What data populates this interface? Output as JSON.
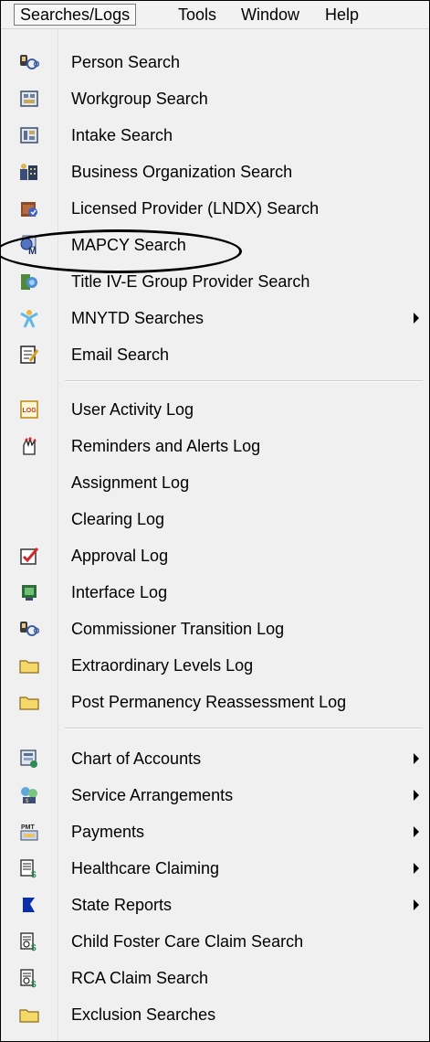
{
  "menubar": {
    "items": [
      "Searches/Logs",
      "Tools",
      "Window",
      "Help"
    ]
  },
  "menu": {
    "items": [
      {
        "label": "Person Search",
        "icon": "binoculars-icon",
        "submenu": false
      },
      {
        "label": "Workgroup Search",
        "icon": "workgroup-icon",
        "submenu": false
      },
      {
        "label": "Intake Search",
        "icon": "intake-icon",
        "submenu": false
      },
      {
        "label": "Business Organization Search",
        "icon": "business-org-icon",
        "submenu": false
      },
      {
        "label": "Licensed Provider (LNDX) Search",
        "icon": "licensed-provider-icon",
        "submenu": false
      },
      {
        "label": "MAPCY Search",
        "icon": "mapcy-icon",
        "submenu": false
      },
      {
        "label": "Title IV-E Group Provider Search",
        "icon": "group-provider-icon",
        "submenu": false
      },
      {
        "label": "MNYTD Searches",
        "icon": "mnytd-person-icon",
        "submenu": true
      },
      {
        "label": "Email Search",
        "icon": "email-note-icon",
        "submenu": false
      },
      {
        "label": "User Activity Log",
        "icon": "log-icon",
        "submenu": false
      },
      {
        "label": "Reminders and Alerts Log",
        "icon": "reminders-icon",
        "submenu": false
      },
      {
        "label": "Assignment Log",
        "icon": "",
        "submenu": false
      },
      {
        "label": "Clearing Log",
        "icon": "",
        "submenu": false
      },
      {
        "label": "Approval Log",
        "icon": "approval-icon",
        "submenu": false
      },
      {
        "label": "Interface Log",
        "icon": "interface-icon",
        "submenu": false
      },
      {
        "label": "Commissioner Transition Log",
        "icon": "binoculars-icon",
        "submenu": false
      },
      {
        "label": "Extraordinary Levels Log",
        "icon": "folder-icon",
        "submenu": false
      },
      {
        "label": "Post Permanency Reassessment Log",
        "icon": "folder-icon",
        "submenu": false
      },
      {
        "label": "Chart of Accounts",
        "icon": "chart-accounts-icon",
        "submenu": true
      },
      {
        "label": "Service Arrangements",
        "icon": "service-arrangements-icon",
        "submenu": true
      },
      {
        "label": "Payments",
        "icon": "payments-icon",
        "submenu": true
      },
      {
        "label": "Healthcare Claiming",
        "icon": "healthcare-claim-icon",
        "submenu": true
      },
      {
        "label": "State Reports",
        "icon": "state-flag-icon",
        "submenu": true
      },
      {
        "label": "Child Foster Care Claim Search",
        "icon": "claim-search-icon",
        "submenu": false
      },
      {
        "label": "RCA Claim Search",
        "icon": "claim-search-icon",
        "submenu": false
      },
      {
        "label": "Exclusion Searches",
        "icon": "folder-icon",
        "submenu": false
      }
    ]
  },
  "icon_text": {
    "log": "LOG",
    "payments": "PMT"
  },
  "colors": {
    "menu_bg": "#f0f0f0",
    "folder": "#f5d86a",
    "highlight_ring": "#000000"
  }
}
